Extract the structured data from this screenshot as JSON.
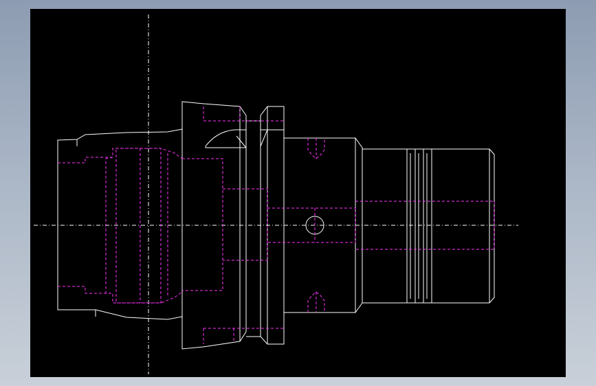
{
  "viewport": {
    "background": "#000000"
  },
  "drawing": {
    "colors": {
      "outline": "#ffffff",
      "hidden_lines": "#ff33ff",
      "centerline": "#ffffff"
    },
    "line_types": [
      "visible-outline",
      "hidden-dashed",
      "center-dash-dot"
    ]
  }
}
